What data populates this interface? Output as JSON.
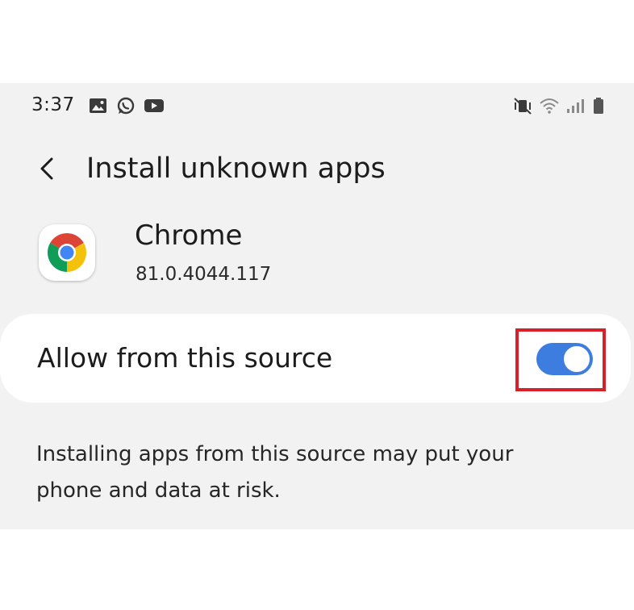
{
  "status_bar": {
    "time": "3:37",
    "left_icons": [
      "gallery-icon",
      "whatsapp-icon",
      "youtube-icon"
    ],
    "right_icons": [
      "mute-vibrate-icon",
      "wifi-icon",
      "signal-icon",
      "battery-icon"
    ]
  },
  "header": {
    "back_icon": "back-chevron-icon",
    "title": "Install unknown apps"
  },
  "app": {
    "icon": "chrome-icon",
    "name": "Chrome",
    "version": "81.0.4044.117"
  },
  "setting": {
    "label": "Allow from this source",
    "enabled": true,
    "highlight_color": "#d81f2a",
    "accent_color": "#3e7de0"
  },
  "warning": {
    "text": "Installing apps from this source may put your phone and data at risk."
  }
}
